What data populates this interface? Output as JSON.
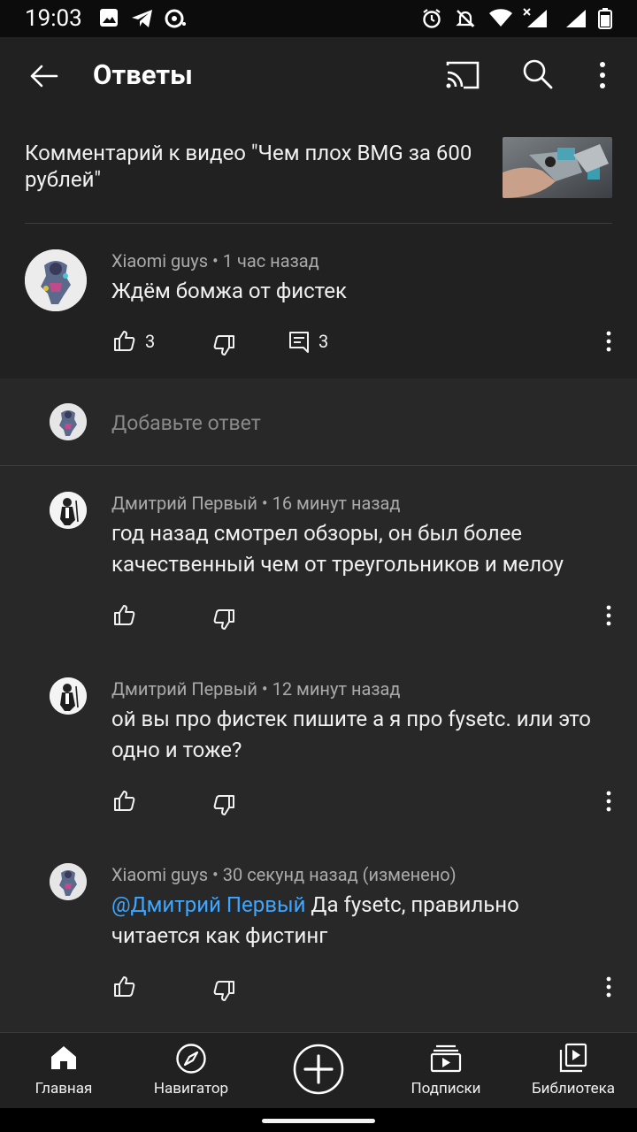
{
  "status_bar": {
    "time": "19:03"
  },
  "header": {
    "title": "Ответы"
  },
  "video_context": {
    "text": "Комментарий к видео \"Чем плох BMG за 600 рублей\""
  },
  "comment": {
    "author": "Xiaomi guys",
    "time": "1 час назад",
    "text": "Ждём бомжа от фистек",
    "likes": "3",
    "replies": "3"
  },
  "add_reply": {
    "placeholder": "Добавьте ответ"
  },
  "replies": [
    {
      "author": "Дмитрий Первый",
      "time": "16 минут назад",
      "text": "год назад смотрел обзоры, он был более качественный чем от треугольников и мелоу"
    },
    {
      "author": "Дмитрий Первый",
      "time": "12 минут назад",
      "text": "ой вы про фистек пишите а я про fysetc. или это одно и тоже?"
    },
    {
      "author": "Xiaomi guys",
      "time": "30 секунд назад (изменено)",
      "mention": "@Дмитрий Первый",
      "text": " Да fysetc, правильно читается как фистинг"
    }
  ],
  "bottom_nav": [
    {
      "label": "Главная",
      "icon": "home-icon"
    },
    {
      "label": "Навигатор",
      "icon": "explore-icon"
    },
    {
      "label": "",
      "icon": "create-icon"
    },
    {
      "label": "Подписки",
      "icon": "subscriptions-icon"
    },
    {
      "label": "Библиотека",
      "icon": "library-icon"
    }
  ],
  "colors": {
    "background": "#282828",
    "surface": "#212121",
    "accent_link": "#3ea6ff",
    "secondary_text": "#aaaaaa"
  }
}
